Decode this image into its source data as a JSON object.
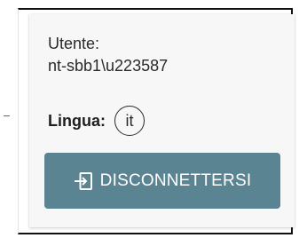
{
  "account_menu": {
    "user_label": "Utente:",
    "user_value": "nt-sbb1\\u223587",
    "language_label": "Lingua:",
    "language_value": "it",
    "logout_icon": "sign-out-icon",
    "logout_label": "DISCONNETTERSI",
    "logout_color": "#5b8492"
  }
}
